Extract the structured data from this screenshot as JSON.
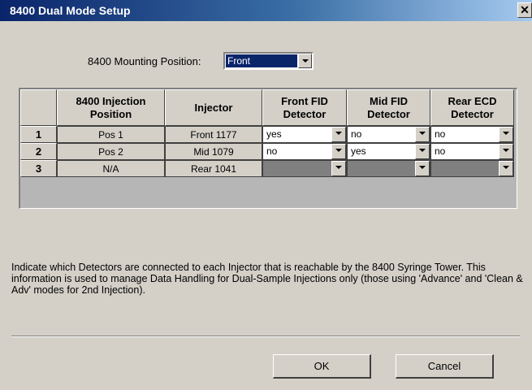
{
  "window": {
    "title": "8400 Dual Mode Setup",
    "close_glyph": "✕"
  },
  "mounting": {
    "label": "8400 Mounting Position:",
    "value": "Front"
  },
  "grid": {
    "headers": [
      "8400 Injection Position",
      "Injector",
      "Front FID Detector",
      "Mid FID Detector",
      "Rear ECD Detector"
    ],
    "rows": [
      {
        "num": "1",
        "position": "Pos 1",
        "injector": "Front 1177",
        "front_fid": "yes",
        "mid_fid": "no",
        "rear_ecd": "no"
      },
      {
        "num": "2",
        "position": "Pos 2",
        "injector": "Mid 1079",
        "front_fid": "no",
        "mid_fid": "yes",
        "rear_ecd": "no"
      },
      {
        "num": "3",
        "position": "N/A",
        "injector": "Rear 1041",
        "front_fid": "",
        "mid_fid": "",
        "rear_ecd": ""
      }
    ]
  },
  "info_text": "Indicate which Detectors are connected to each Injector that is reachable by the 8400 Syringe Tower.  This information is used to manage Data Handling for Dual-Sample Injections only (those using 'Advance' and 'Clean & Adv' modes for 2nd Injection).",
  "buttons": {
    "ok": "OK",
    "cancel": "Cancel"
  },
  "colors": {
    "title_bar": "#0a246a",
    "dialog_bg": "#d4d0c8",
    "selection": "#0a246a",
    "disabled_cell": "#808080"
  }
}
